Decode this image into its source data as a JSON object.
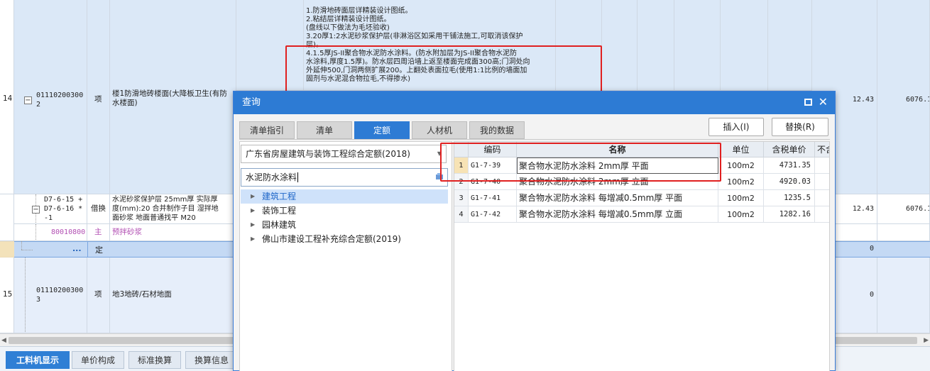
{
  "grid": {
    "row14": {
      "num": "14",
      "code_line1": "01110200300",
      "code_line2": "2",
      "type": "项",
      "name": "楼1防滑地砖楼面(大降板卫生(有防水楼面)",
      "desc_lines": [
        "1.防滑地砖面层详精装设计图纸。",
        "2.粘结层详精装设计图纸。",
        "(盘线以下做法为毛坯验收)",
        "3.20厚1:2水泥砂浆保护层(非淋浴区如采用干铺法施工,可取消该保护",
        "层)。",
        "4.1.5厚JS-II聚合物水泥防水涂料。(防水附加层为JS-II聚合物水泥防",
        "水涂料,厚度1.5厚)。防水层四周沿墙上返至楼面完成面300高;门洞处向",
        "外延伸500,门洞两侧扩展200。上翻处表面拉毛(使用1:1比例的墙面加",
        "固剂与水泥混合物拉毛,不得掺水)"
      ],
      "qty": "12.43",
      "total": "6076.1"
    },
    "sub1": {
      "code_lines": [
        "D7-6-15 +",
        "D7-6-16 *",
        "-1"
      ],
      "type": "借换",
      "name_lines": [
        "水泥砂浆保护层 25mm厚  实际厚",
        "度(mm):20  合并制作子目 湿拌地",
        "面砂浆 地面普通找平 M20"
      ],
      "qty": "12.43",
      "total": "6076.1"
    },
    "sub2": {
      "code": "80010800",
      "type": "主",
      "name": "预拌砂浆"
    },
    "sub3": {
      "code": "...",
      "type": "定",
      "value": "0"
    },
    "row15": {
      "num": "15",
      "code_line1": "01110200300",
      "code_line2": "3",
      "type": "项",
      "name": "地3地砖/石材地面",
      "value": "0"
    }
  },
  "bottom_tabs": [
    "工料机显示",
    "单价构成",
    "标准换算",
    "换算信息"
  ],
  "dialog": {
    "title": "查询",
    "tabs": [
      "清单指引",
      "清单",
      "定额",
      "人材机",
      "我的数据"
    ],
    "active_tab": "定额",
    "insert_button": "插入(I)",
    "replace_button": "替换(R)",
    "library": "广东省房屋建筑与装饰工程综合定额(2018)",
    "search_value": "水泥防水涂料",
    "tree": [
      "建筑工程",
      "装饰工程",
      "园林建筑",
      "佛山市建设工程补充综合定额(2019)"
    ],
    "table": {
      "headers": [
        "编码",
        "名称",
        "单位",
        "含税单价",
        "不含"
      ],
      "rows": [
        {
          "no": "1",
          "code": "G1-7-39",
          "name": "聚合物水泥防水涂料 2mm厚 平面",
          "unit": "100m2",
          "price": "4731.35"
        },
        {
          "no": "2",
          "code": "G1-7-40",
          "name": "聚合物水泥防水涂料 2mm厚 立面",
          "unit": "100m2",
          "price": "4920.03"
        },
        {
          "no": "3",
          "code": "G1-7-41",
          "name": "聚合物水泥防水涂料 每增减0.5mm厚 平面",
          "unit": "100m2",
          "price": "1235.5"
        },
        {
          "no": "4",
          "code": "G1-7-42",
          "name": "聚合物水泥防水涂料 每增减0.5mm厚 立面",
          "unit": "100m2",
          "price": "1282.16"
        }
      ]
    }
  },
  "colors": {
    "accent": "#2d7bd4",
    "highlight_box": "#e02020",
    "material_text": "#b24fb3"
  }
}
